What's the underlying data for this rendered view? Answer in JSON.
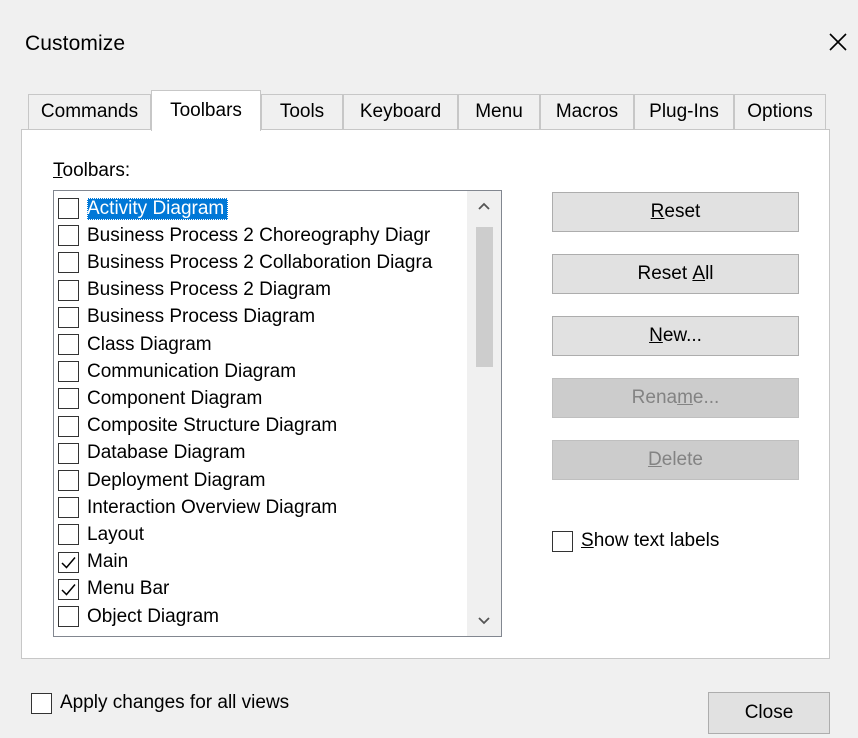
{
  "dialog": {
    "title": "Customize"
  },
  "tabs": [
    {
      "label": "Commands"
    },
    {
      "label": "Toolbars"
    },
    {
      "label": "Tools"
    },
    {
      "label": "Keyboard"
    },
    {
      "label": "Menu"
    },
    {
      "label": "Macros"
    },
    {
      "label": "Plug-Ins"
    },
    {
      "label": "Options"
    }
  ],
  "active_tab": "Toolbars",
  "toolbars_label": {
    "accel": "T",
    "rest": "oolbars:"
  },
  "toolbar_list": [
    {
      "label": "Activity Diagram",
      "checked": false,
      "selected": true
    },
    {
      "label": "Business Process 2 Choreography Diagr",
      "checked": false
    },
    {
      "label": "Business Process 2 Collaboration Diagra",
      "checked": false
    },
    {
      "label": "Business Process 2 Diagram",
      "checked": false
    },
    {
      "label": "Business Process Diagram",
      "checked": false
    },
    {
      "label": "Class Diagram",
      "checked": false
    },
    {
      "label": "Communication Diagram",
      "checked": false
    },
    {
      "label": "Component Diagram",
      "checked": false
    },
    {
      "label": "Composite Structure Diagram",
      "checked": false
    },
    {
      "label": "Database Diagram",
      "checked": false
    },
    {
      "label": "Deployment Diagram",
      "checked": false
    },
    {
      "label": "Interaction Overview Diagram",
      "checked": false
    },
    {
      "label": "Layout",
      "checked": false
    },
    {
      "label": "Main",
      "checked": true
    },
    {
      "label": "Menu Bar",
      "checked": true
    },
    {
      "label": "Object Diagram",
      "checked": false
    }
  ],
  "buttons": {
    "reset": {
      "accel": "R",
      "rest": "eset",
      "enabled": true
    },
    "reset_all": {
      "pre": "Reset ",
      "accel": "A",
      "rest": "ll",
      "enabled": true
    },
    "new": {
      "accel": "N",
      "rest": "ew...",
      "enabled": true
    },
    "rename": {
      "pre": "Rena",
      "accel": "m",
      "rest": "e...",
      "enabled": false
    },
    "delete": {
      "accel": "D",
      "rest": "elete",
      "enabled": false
    }
  },
  "show_text_labels": {
    "accel": "S",
    "rest": "how text labels",
    "checked": false
  },
  "apply_all_views": {
    "label": "Apply changes for all views",
    "checked": false
  },
  "close_button": {
    "label": "Close"
  },
  "icons": {
    "close": "close-icon",
    "scroll_up": "chevron-up-icon",
    "scroll_down": "chevron-down-icon",
    "check": "checkmark-icon"
  },
  "colors": {
    "selection": "#0078d7",
    "disabled_text": "#838383"
  }
}
